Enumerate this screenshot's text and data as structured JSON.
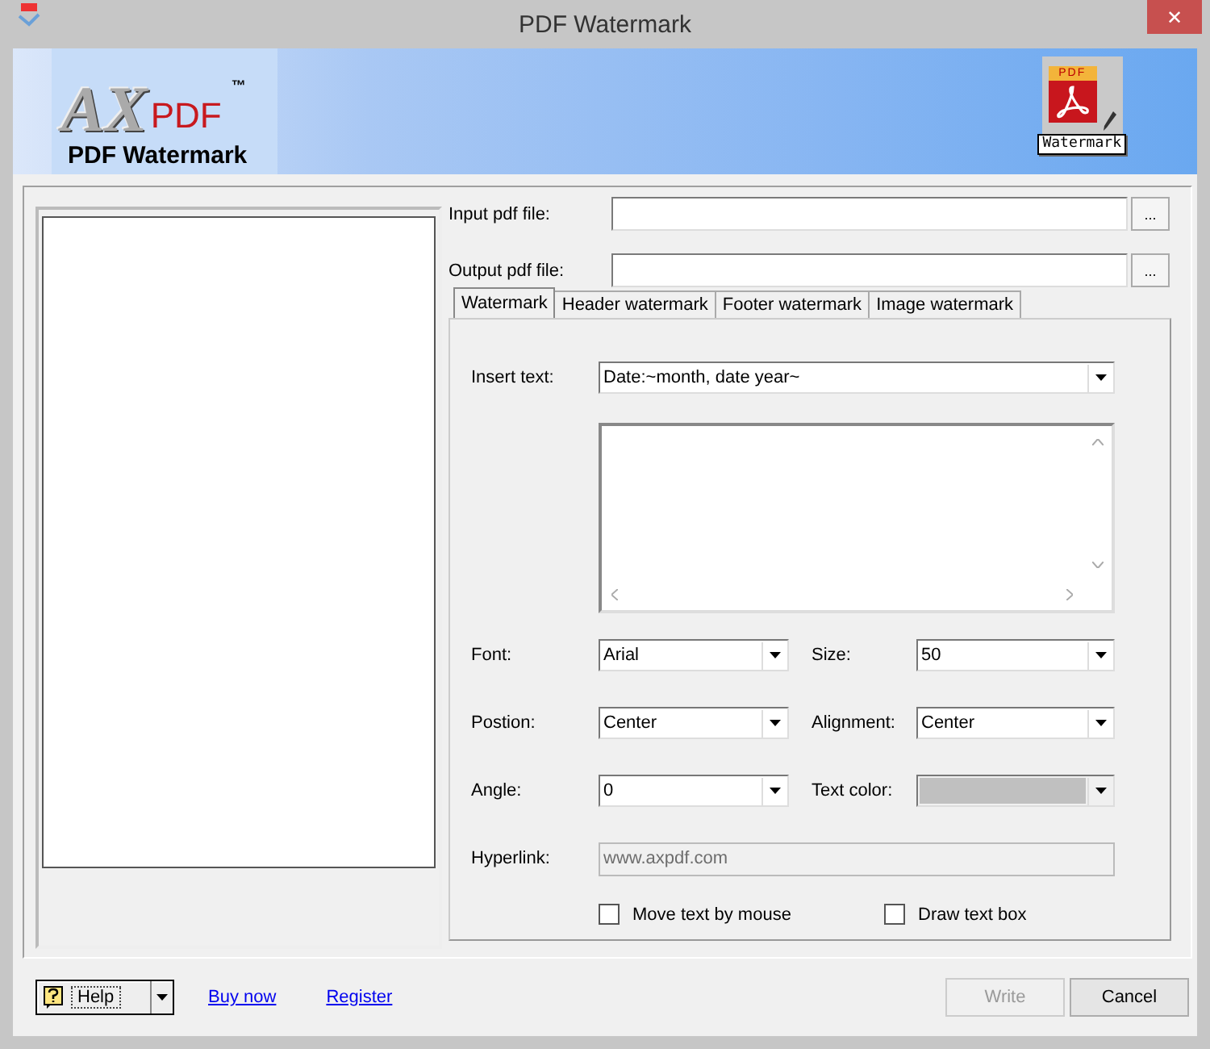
{
  "window": {
    "title": "PDF Watermark",
    "close": "✕"
  },
  "banner": {
    "logo_letters": "AX",
    "logo_pdf": "PDF",
    "trademark": "™",
    "product": "PDF Watermark",
    "badge_tag": "PDF",
    "badge": "Watermark"
  },
  "files": [
    {
      "label": "Input pdf file:",
      "browse": "..."
    },
    {
      "label": "Output pdf file:",
      "browse": "..."
    }
  ],
  "tabs": [
    {
      "label": "Watermark",
      "selected": true
    },
    {
      "label": "Header watermark",
      "selected": false
    },
    {
      "label": "Footer watermark",
      "selected": false
    },
    {
      "label": "Image watermark",
      "selected": false
    }
  ],
  "watermark": {
    "insert_text": {
      "label": "Insert text:",
      "value": "Date:~month, date year~"
    },
    "fields": [
      {
        "label": "Font:",
        "value": "Arial",
        "disabled": false
      },
      {
        "label": "Size:",
        "value": "50",
        "disabled": false
      },
      {
        "label": "Postion:",
        "value": "Center",
        "disabled": false
      },
      {
        "label": "Alignment:",
        "value": "Center",
        "disabled": false
      },
      {
        "label": "Angle:",
        "value": "0",
        "disabled": false
      },
      {
        "label": "Text color:",
        "disabled": true
      }
    ],
    "hyperlink": {
      "label": "Hyperlink:",
      "value": "www.axpdf.com",
      "disabled": true
    },
    "options": [
      {
        "label": "Move text by mouse",
        "checked": false
      },
      {
        "label": "Draw text box",
        "checked": false
      }
    ]
  },
  "footer": {
    "help": "Help",
    "links": [
      "Buy now",
      "Register"
    ],
    "buttons": [
      {
        "label": "Write",
        "disabled": true
      },
      {
        "label": "Cancel",
        "disabled": false
      }
    ]
  }
}
